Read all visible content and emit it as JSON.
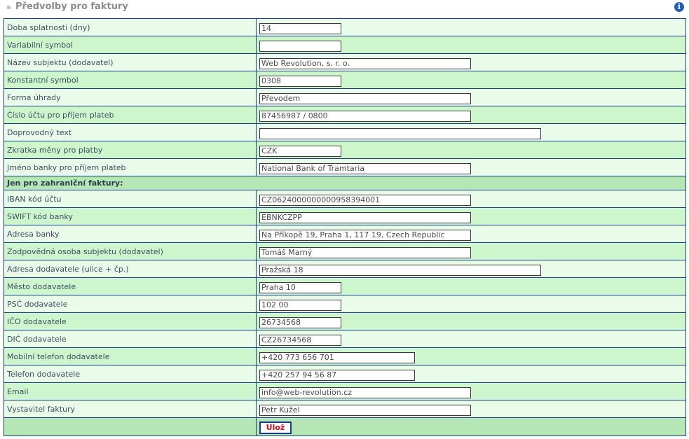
{
  "header": {
    "title": "Předvolby pro faktury",
    "info_icon": "info-icon"
  },
  "rows": [
    {
      "label": "Doba splatnosti (dny)",
      "value": "14"
    },
    {
      "label": "Variabilní symbol",
      "value": ""
    },
    {
      "label": "Název subjektu (dodavatel)",
      "value": "Web Revolution, s. r. o."
    },
    {
      "label": "Konstantní symbol",
      "value": "0308"
    },
    {
      "label": "Forma úhrady",
      "value": "Převodem"
    },
    {
      "label": "Číslo účtu pro příjem plateb",
      "value": "87456987 / 0800"
    },
    {
      "label": "Doprovodný text",
      "value": ""
    },
    {
      "label": "Zkratka měny pro platby",
      "value": "CZK"
    },
    {
      "label": "Jméno banky pro příjem plateb",
      "value": "National Bank of Tramtaria"
    }
  ],
  "section": {
    "label": "Jen pro zahraniční faktury:"
  },
  "foreign_rows": [
    {
      "label": "IBAN kód účtu",
      "value": "CZ0624000000000958394001"
    },
    {
      "label": "SWIFT kód banky",
      "value": "EBNKCZPP"
    },
    {
      "label": "Adresa banky",
      "value": "Na Příkopě 19, Praha 1, 117 19, Czech Republic"
    },
    {
      "label": "Zodpovědná osoba subjektu (dodavatel)",
      "value": "Tomáš Marný"
    },
    {
      "label": "Adresa dodavatele (ulice + čp.)",
      "value": "Pražská 18"
    },
    {
      "label": "Město dodavatele",
      "value": "Praha 10"
    },
    {
      "label": "PSČ dodavatele",
      "value": "102 00"
    },
    {
      "label": "IČO dodavatele",
      "value": "26734568"
    },
    {
      "label": "DIČ dodavatele",
      "value": "CZ26734568"
    },
    {
      "label": "Mobilní telefon dodavatele",
      "value": "+420 773 656 701"
    },
    {
      "label": "Telefon dodavatele",
      "value": "+420 257 94 56 87"
    },
    {
      "label": "Email",
      "value": "info@web-revolution.cz"
    },
    {
      "label": "Vystavitel faktury",
      "value": "Petr Kužel"
    }
  ],
  "footer": {
    "save_label": "Ulož"
  }
}
